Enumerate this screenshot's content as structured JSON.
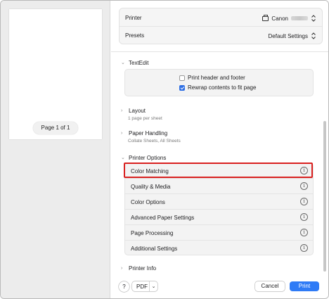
{
  "preview": {
    "page_indicator": "Page 1 of 1"
  },
  "header": {
    "printer_label": "Printer",
    "printer_value": "Canon",
    "presets_label": "Presets",
    "presets_value": "Default Settings"
  },
  "textedit": {
    "title": "TextEdit",
    "options": [
      {
        "label": "Print header and footer",
        "checked": false
      },
      {
        "label": "Rewrap contents to fit page",
        "checked": true
      }
    ]
  },
  "layout": {
    "title": "Layout",
    "summary": "1 page per sheet"
  },
  "paper_handling": {
    "title": "Paper Handling",
    "summary": "Collate Sheets, All Sheets"
  },
  "printer_options": {
    "title": "Printer Options",
    "items": [
      {
        "label": "Color Matching",
        "highlighted": true
      },
      {
        "label": "Quality & Media"
      },
      {
        "label": "Color Options"
      },
      {
        "label": "Advanced Paper Settings"
      },
      {
        "label": "Page Processing"
      },
      {
        "label": "Additional Settings"
      }
    ]
  },
  "printer_info": {
    "title": "Printer Info"
  },
  "footer": {
    "help_label": "?",
    "pdf_label": "PDF",
    "cancel_label": "Cancel",
    "print_label": "Print"
  },
  "colors": {
    "accent": "#2f7bf6",
    "highlight": "#d9201f"
  },
  "icons": {
    "info": "info-circle-icon",
    "chevron": "chevron-icon",
    "printer": "printer-icon",
    "updown": "updown-arrows-icon"
  }
}
